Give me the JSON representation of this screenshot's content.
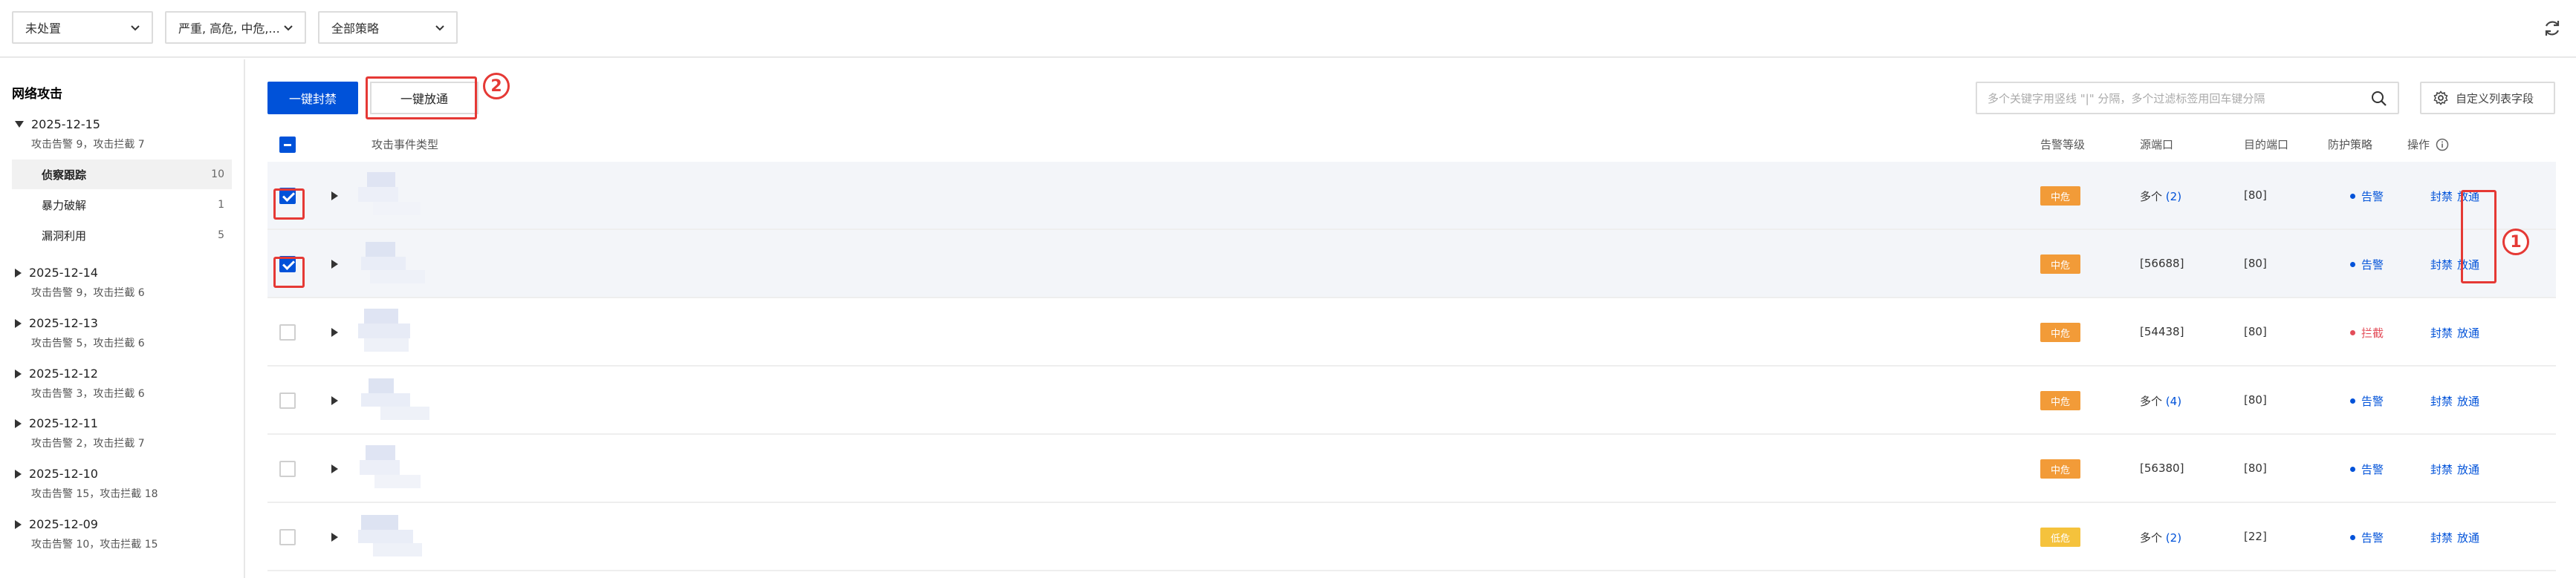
{
  "filters": {
    "status": "未处置",
    "severity": "严重, 高危, 中危,...",
    "policy": "全部策略"
  },
  "sidebar": {
    "title": "网络攻击",
    "groups": [
      {
        "date": "2025-12-15",
        "summary": "攻击告警 9，攻击拦截 7",
        "expanded": true,
        "children": [
          {
            "label": "侦察跟踪",
            "count": "10",
            "active": true
          },
          {
            "label": "暴力破解",
            "count": "1",
            "active": false
          },
          {
            "label": "漏洞利用",
            "count": "5",
            "active": false
          }
        ]
      },
      {
        "date": "2025-12-14",
        "summary": "攻击告警 9，攻击拦截 6",
        "expanded": false
      },
      {
        "date": "2025-12-13",
        "summary": "攻击告警 5，攻击拦截 6",
        "expanded": false
      },
      {
        "date": "2025-12-12",
        "summary": "攻击告警 3，攻击拦截 6",
        "expanded": false
      },
      {
        "date": "2025-12-11",
        "summary": "攻击告警 2，攻击拦截 7",
        "expanded": false
      },
      {
        "date": "2025-12-10",
        "summary": "攻击告警 15，攻击拦截 18",
        "expanded": false
      },
      {
        "date": "2025-12-09",
        "summary": "攻击告警 10，攻击拦截 15",
        "expanded": false
      }
    ]
  },
  "toolbar": {
    "block_all": "一键封禁",
    "allow_all": "一键放通",
    "search_placeholder": "多个关键字用竖线 \"|\" 分隔，多个过滤标签用回车键分隔",
    "custom_columns": "自定义列表字段"
  },
  "annotations": {
    "one": "1",
    "two": "2"
  },
  "table": {
    "headers": {
      "type": "攻击事件类型",
      "level": "告警等级",
      "src_port": "源端口",
      "dst_port": "目的端口",
      "policy": "防护策略",
      "action": "操作"
    },
    "rows": [
      {
        "checked": true,
        "level": "中危",
        "level_color": "#f29b38",
        "src_port": "多个",
        "src_count": "(2)",
        "dst_port": "[80]",
        "policy": "告警",
        "policy_color": "#0052d9"
      },
      {
        "checked": true,
        "level": "中危",
        "level_color": "#f29b38",
        "src_port": "[56688]",
        "src_count": "",
        "dst_port": "[80]",
        "policy": "告警",
        "policy_color": "#0052d9"
      },
      {
        "checked": false,
        "level": "中危",
        "level_color": "#f29b38",
        "src_port": "[54438]",
        "src_count": "",
        "dst_port": "[80]",
        "policy": "拦截",
        "policy_color": "#e34d59"
      },
      {
        "checked": false,
        "level": "中危",
        "level_color": "#f29b38",
        "src_port": "多个",
        "src_count": "(4)",
        "dst_port": "[80]",
        "policy": "告警",
        "policy_color": "#0052d9"
      },
      {
        "checked": false,
        "level": "中危",
        "level_color": "#f29b38",
        "src_port": "[56380]",
        "src_count": "",
        "dst_port": "[80]",
        "policy": "告警",
        "policy_color": "#0052d9"
      },
      {
        "checked": false,
        "level": "低危",
        "level_color": "#f5c23c",
        "src_port": "多个",
        "src_count": "(2)",
        "dst_port": "[22]",
        "policy": "告警",
        "policy_color": "#0052d9"
      }
    ],
    "actions": {
      "block": "封禁",
      "allow": "放通"
    }
  }
}
